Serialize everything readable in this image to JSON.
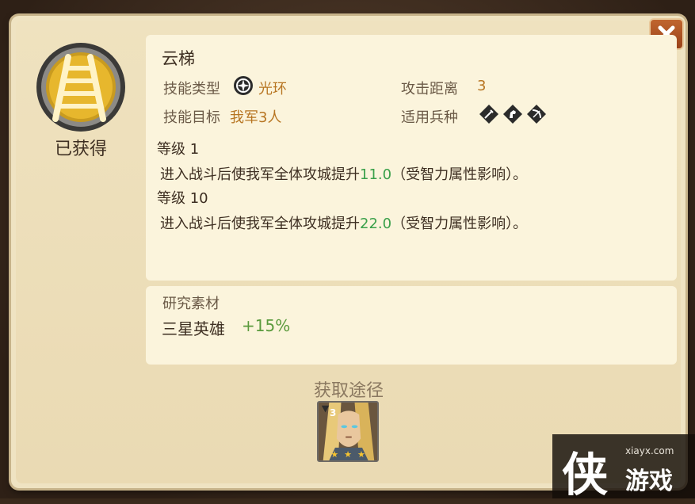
{
  "skill": {
    "name": "云梯",
    "status": "已获得",
    "type_label": "技能类型",
    "type_value": "光环",
    "range_label": "攻击距离",
    "range_value": "3",
    "target_label": "技能目标",
    "target_value": "我军3人",
    "troop_label": "适用兵种",
    "troop_icons": [
      "sword-icon",
      "horse-icon",
      "bow-icon"
    ]
  },
  "levels": [
    {
      "label": "等级",
      "level": "1",
      "desc_prefix": "进入战斗后使我军全体攻城提升",
      "value": "11.0",
      "desc_suffix": "（受智力属性影响）。"
    },
    {
      "label": "等级",
      "level": "10",
      "desc_prefix": "进入战斗后使我军全体攻城提升",
      "value": "22.0",
      "desc_suffix": "（受智力属性影响）。"
    }
  ],
  "material": {
    "title": "研究素材",
    "name": "三星英雄",
    "bonus": "+15%"
  },
  "source": {
    "title": "获取途径",
    "hero_stars": "3"
  },
  "watermark": {
    "url": "xiayx.com",
    "char": "侠",
    "text": "游戏"
  },
  "colors": {
    "accent": "#b77522",
    "green": "#3aa04a",
    "close": "#b0542a"
  }
}
